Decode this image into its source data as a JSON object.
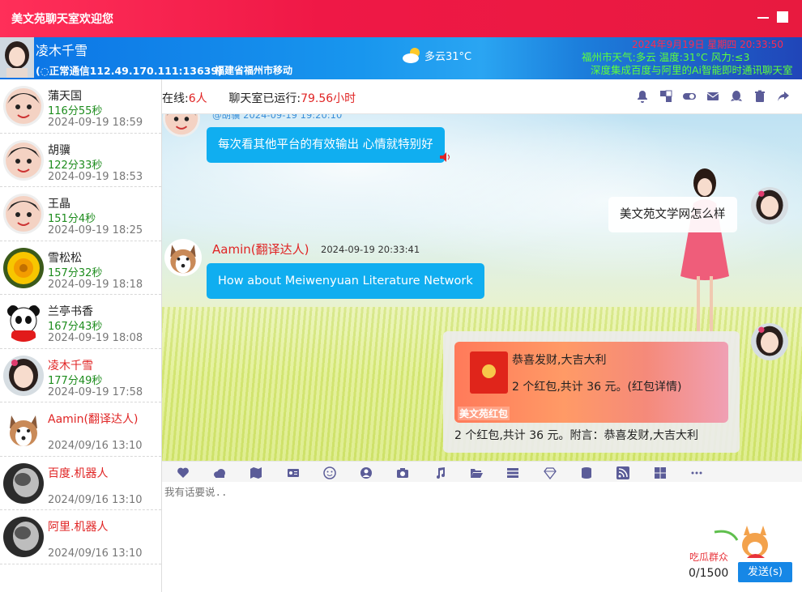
{
  "window": {
    "title": "美文苑聊天室欢迎您"
  },
  "header": {
    "username": "凌木千雪",
    "connection": "正常通信112.49.170.111:13639)",
    "location": "福建省福州市移动",
    "weather": "多云31°C",
    "ticker_top": "2024年9月19日   星期四   20:33:50",
    "ticker_weather": "福州市天气:多云 温度:31°C 风力:≤3",
    "ticker_intro": "深度集成百度与阿里的Ai智能即时通讯聊天室"
  },
  "sidebar": {
    "users": [
      {
        "name": "蒲天国",
        "duration": "116分55秒",
        "time": "2024-09-19 18:59",
        "avatar": "boy-avatar"
      },
      {
        "name": "胡骥",
        "duration": "122分33秒",
        "time": "2024-09-19 18:53",
        "avatar": "boy-avatar"
      },
      {
        "name": "王晶",
        "duration": "151分4秒",
        "time": "2024-09-19 18:25",
        "avatar": "boy-avatar"
      },
      {
        "name": "雪松松",
        "duration": "157分32秒",
        "time": "2024-09-19 18:18",
        "avatar": "flower-avatar"
      },
      {
        "name": "兰亭书香",
        "duration": "167分43秒",
        "time": "2024-09-19 18:08",
        "avatar": "panda-avatar"
      },
      {
        "name": "凌木千雪",
        "duration": "177分49秒",
        "time": "2024-09-19 17:58",
        "avatar": "girl-avatar"
      },
      {
        "name": "Aamin(翻译达人)",
        "duration": "",
        "time": "2024/09/16 13:10",
        "avatar": "husky-avatar"
      },
      {
        "name": "百度.机器人",
        "duration": "",
        "time": "2024/09/16 13:10",
        "avatar": "robot-avatar"
      },
      {
        "name": "阿里.机器人",
        "duration": "",
        "time": "2024/09/16 13:10",
        "avatar": "robot-avatar"
      }
    ]
  },
  "toolbar": {
    "online_label": "在线:",
    "online_count": "6人",
    "uptime_label": "聊天室已运行:",
    "uptime_value": "79.56小时"
  },
  "chat": {
    "partial_meta": "@胡骥  2024-09-19 19:20:10",
    "msg1": "每次看其他平台的有效输出 心情就特别好",
    "msg2": "美文苑文学网怎么样",
    "msg3_name": "Aamin(翻译达人)",
    "msg3_time": "2024-09-19 20:33:41",
    "msg3": "How about Meiwenyuan Literature Network",
    "packet": {
      "title": "恭喜发财,大吉大利",
      "count": "2 个红包,共计 36 元。(红包详情)",
      "brand": "美文苑红包",
      "desc": "2 个红包,共计 36 元。附言：恭喜发财,大吉大利"
    }
  },
  "input": {
    "placeholder": "我有话要说..",
    "counter": "0/1500",
    "send_label": "发送(s)",
    "mascot_text": "吃瓜群众"
  },
  "colors": {
    "accent": "#1687e6",
    "title_bar": "#ef1846",
    "bubble": "#10aef0",
    "icon": "#5b5c98"
  }
}
